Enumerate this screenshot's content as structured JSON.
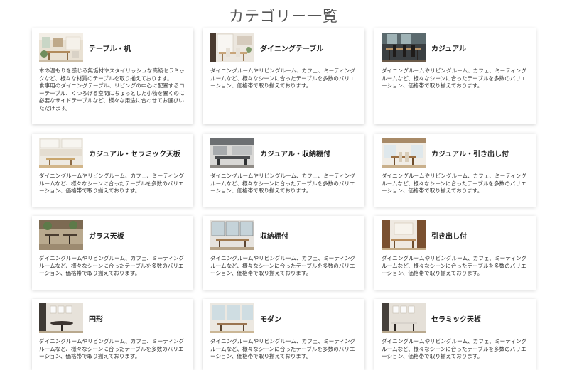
{
  "page": {
    "title": "カテゴリー一覧"
  },
  "categories": [
    {
      "title": "テーブル・机",
      "thumb_icon": "living-room-photo-icon",
      "description": "木の温もりを感じる無垢材やスタイリッシュな高級セラミックなど、様々な材質のテーブルを取り揃えております。\n食事用のダイニングテーブル、リビングの中心に配置するローテーブル、くつろげる空間にちょっとした小物を置くのに必要なサイドテーブルなど、様々な用途に合わせてお選びいただけます。"
    },
    {
      "title": "ダイニングテーブル",
      "thumb_icon": "dining-room-photo-icon",
      "description": "ダイニングルームやリビングルーム、カフェ、ミーティングルームなど、様々なシーンに合ったテーブルを多数のバリエーション、価格帯で取り揃えております。"
    },
    {
      "title": "カジュアル",
      "thumb_icon": "casual-dining-photo-icon",
      "description": "ダイニングルームやリビングルーム、カフェ、ミーティングルームなど、様々なシーンに合ったテーブルを多数のバリエーション、価格帯で取り揃えております。"
    },
    {
      "title": "カジュアル・セラミック天板",
      "thumb_icon": "kitchen-photo-icon",
      "description": "ダイニングルームやリビングルーム、カフェ、ミーティングルームなど、様々なシーンに合ったテーブルを多数のバリエーション、価格帯で取り揃えております。"
    },
    {
      "title": "カジュアル・収納棚付",
      "thumb_icon": "open-kitchen-photo-icon",
      "description": "ダイニングルームやリビングルーム、カフェ、ミーティングルームなど、様々なシーンに合ったテーブルを多数のバリエーション、価格帯で取り揃えております。"
    },
    {
      "title": "カジュアル・引き出し付",
      "thumb_icon": "bright-dining-photo-icon",
      "description": "ダイニングルームやリビングルーム、カフェ、ミーティングルームなど、様々なシーンに合ったテーブルを多数のバリエーション、価格帯で取り揃えております。"
    },
    {
      "title": "ガラス天板",
      "thumb_icon": "cafe-terrace-photo-icon",
      "description": "ダイニングルームやリビングルーム、カフェ、ミーティングルームなど、様々なシーンに合ったテーブルを多数のバリエーション、価格帯で取り揃えております。"
    },
    {
      "title": "収納棚付",
      "thumb_icon": "window-dining-photo-icon",
      "description": "ダイニングルームやリビングルーム、カフェ、ミーティングルームなど、様々なシーンに合ったテーブルを多数のバリエーション、価格帯で取り揃えております。"
    },
    {
      "title": "引き出し付",
      "thumb_icon": "wood-wall-dining-photo-icon",
      "description": "ダイニングルームやリビングルーム、カフェ、ミーティングルームなど、様々なシーンに合ったテーブルを多数のバリエーション、価格帯で取り揃えております。"
    },
    {
      "title": "円形",
      "thumb_icon": "round-table-photo-icon",
      "description": "ダイニングルームやリビングルーム、カフェ、ミーティングルームなど、様々なシーンに合ったテーブルを多数のバリエーション、価格帯で取り揃えております。"
    },
    {
      "title": "モダン",
      "thumb_icon": "modern-dining-photo-icon",
      "description": "ダイニングルームやリビングルーム、カフェ、ミーティングルームなど、様々なシーンに合ったテーブルを多数のバリエーション、価格帯で取り揃えております。"
    },
    {
      "title": "セラミック天板",
      "thumb_icon": "ceramic-table-photo-icon",
      "description": "ダイニングルームやリビングルーム、カフェ、ミーティングルームなど、様々なシーンに合ったテーブルを多数のバリエーション、価格帯で取り揃えております。"
    }
  ]
}
